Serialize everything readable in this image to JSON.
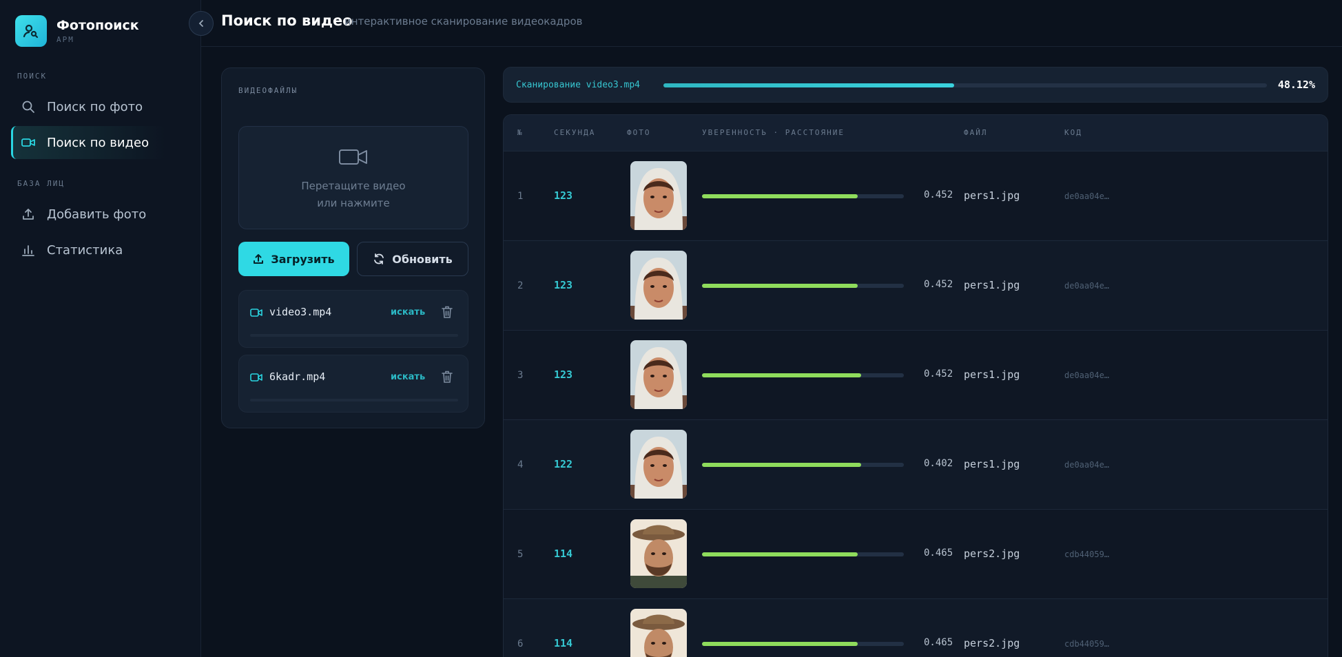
{
  "app": {
    "title": "Фотопоиск",
    "subtitle": "АРМ"
  },
  "sidebar": {
    "sections": [
      {
        "label": "ПОИСК"
      },
      {
        "label": "БАЗА ЛИЦ"
      }
    ],
    "items": [
      {
        "label": "Поиск по фото",
        "icon": "search-icon",
        "active": false
      },
      {
        "label": "Поиск по видео",
        "icon": "video-icon",
        "active": true
      },
      {
        "label": "Добавить фото",
        "icon": "upload-icon",
        "active": false
      },
      {
        "label": "Статистика",
        "icon": "bar-chart-icon",
        "active": false
      }
    ]
  },
  "header": {
    "title": "Поиск по видео",
    "subtitle": "интерактивное сканирование видеокадров"
  },
  "files": {
    "label": "ВИДЕОФАЙЛЫ",
    "dropzone_line1": "Перетащите видео",
    "dropzone_line2": "или нажмите",
    "upload_label": "Загрузить",
    "refresh_label": "Обновить",
    "items": [
      {
        "name": "video3.mp4",
        "action": "искать"
      },
      {
        "name": "6kadr.mp4",
        "action": "искать"
      }
    ]
  },
  "scan": {
    "label": "Сканирование video3.mp4",
    "percent_text": "48.12%",
    "progress": 0.4812
  },
  "table": {
    "headers": {
      "num": "№",
      "second": "СЕКУНДА",
      "photo": "ФОТО",
      "confidence": "УВЕРЕННОСТЬ · РАССТОЯНИЕ",
      "file": "ФАЙЛ",
      "code": "КОД"
    },
    "rows": [
      {
        "num": "1",
        "second": "123",
        "confidence": 0.77,
        "distance": "0.452",
        "file": "pers1.jpg",
        "code": "de0aa04e…",
        "person": "pers1"
      },
      {
        "num": "2",
        "second": "123",
        "confidence": 0.77,
        "distance": "0.452",
        "file": "pers1.jpg",
        "code": "de0aa04e…",
        "person": "pers1"
      },
      {
        "num": "3",
        "second": "123",
        "confidence": 0.79,
        "distance": "0.452",
        "file": "pers1.jpg",
        "code": "de0aa04e…",
        "person": "pers1"
      },
      {
        "num": "4",
        "second": "122",
        "confidence": 0.79,
        "distance": "0.402",
        "file": "pers1.jpg",
        "code": "de0aa04e…",
        "person": "pers1"
      },
      {
        "num": "5",
        "second": "114",
        "confidence": 0.77,
        "distance": "0.465",
        "file": "pers2.jpg",
        "code": "cdb44059…",
        "person": "pers2"
      },
      {
        "num": "6",
        "second": "114",
        "confidence": 0.77,
        "distance": "0.465",
        "file": "pers2.jpg",
        "code": "cdb44059…",
        "person": "pers2"
      }
    ]
  },
  "colors": {
    "accent": "#2fd9e4",
    "confidence": "#8fdc5c",
    "background": "#0b121d"
  }
}
